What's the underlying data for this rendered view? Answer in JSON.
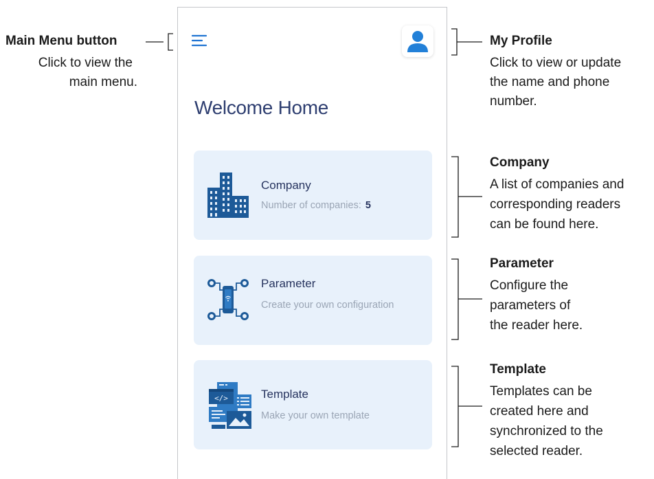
{
  "app": {
    "page_title": "Welcome Home"
  },
  "header": {
    "menu_icon": "hamburger-menu-icon",
    "profile_icon": "user-avatar-icon"
  },
  "cards": [
    {
      "title": "Company",
      "subtitle": "Number of companies:",
      "count": "5",
      "icon": "building-icon"
    },
    {
      "title": "Parameter",
      "subtitle": "Create your own configuration",
      "icon": "device-network-icon"
    },
    {
      "title": "Template",
      "subtitle": "Make your own template",
      "icon": "template-code-icon"
    }
  ],
  "annotations": {
    "main_menu": {
      "title": "Main Menu button",
      "lines": [
        "Click to view the",
        "main menu."
      ]
    },
    "my_profile": {
      "title": "My Profile",
      "lines": [
        "Click to view or update",
        "the name and phone",
        "number."
      ]
    },
    "company": {
      "title": "Company",
      "lines": [
        "A list of companies and",
        "corresponding readers",
        "can be found here."
      ]
    },
    "parameter": {
      "title": "Parameter",
      "lines": [
        "Configure the",
        "parameters of",
        "the reader here."
      ]
    },
    "template": {
      "title": "Template",
      "lines": [
        "Templates can be",
        "created here and",
        "synchronized to the",
        "selected reader."
      ]
    }
  },
  "colors": {
    "accent": "#1f73d2",
    "title": "#2e3e70",
    "card_bg": "#e8f1fb",
    "icon_dark": "#1d5a98"
  }
}
